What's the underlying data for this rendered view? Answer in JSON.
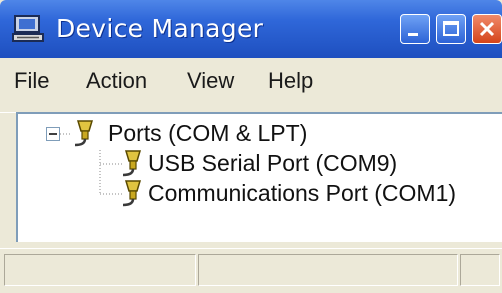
{
  "window": {
    "title": "Device Manager"
  },
  "menu": [
    "File",
    "Action",
    "View",
    "Help"
  ],
  "tree": {
    "root": {
      "label": "Ports (COM & LPT)",
      "expanded": true,
      "icon": "port-icon"
    },
    "children": [
      {
        "label": "USB Serial Port (COM9)",
        "icon": "port-icon"
      },
      {
        "label": "Communications Port (COM1)",
        "icon": "port-icon"
      }
    ]
  },
  "colors": {
    "titlebar": "#2f67d9",
    "close": "#d5441a",
    "background": "#ece9d8"
  }
}
